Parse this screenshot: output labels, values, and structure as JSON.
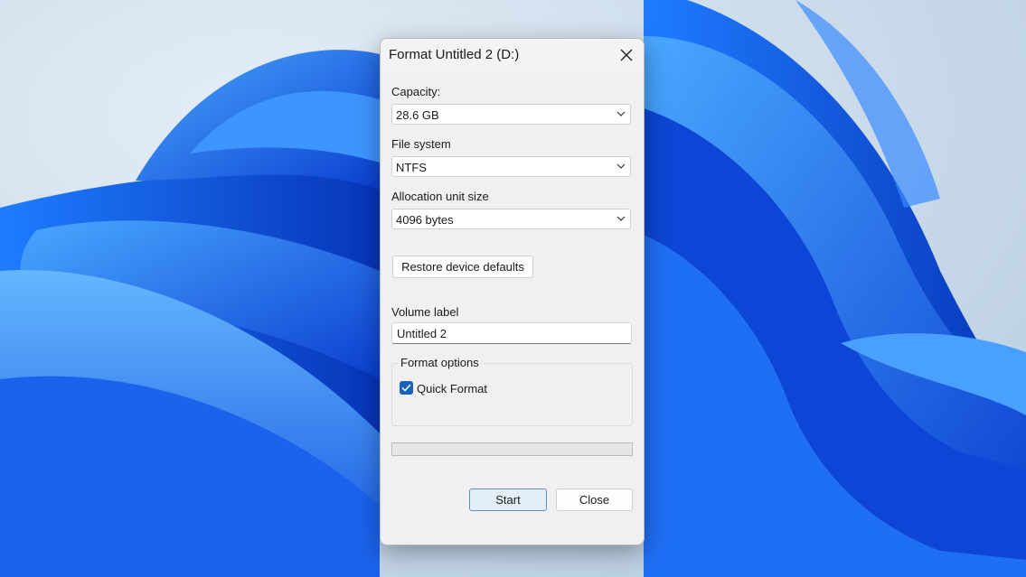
{
  "dialog": {
    "title": "Format Untitled 2 (D:)",
    "capacity": {
      "label": "Capacity:",
      "value": "28.6 GB"
    },
    "file_system": {
      "label": "File system",
      "value": "NTFS"
    },
    "allocation": {
      "label": "Allocation unit size",
      "value": "4096 bytes"
    },
    "restore_label": "Restore device defaults",
    "volume": {
      "label": "Volume label",
      "value": "Untitled 2"
    },
    "format_options": {
      "legend": "Format options",
      "quick_format_label": "Quick Format",
      "quick_format_checked": true
    },
    "progress": 0,
    "start_label": "Start",
    "close_label": "Close"
  },
  "colors": {
    "accent": "#1a62b8",
    "wallpaper_bg": "#c9d9e8",
    "dialog_bg": "#f0f0f0"
  }
}
